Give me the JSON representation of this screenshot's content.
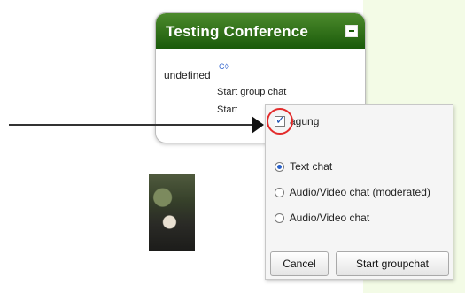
{
  "conference": {
    "title": "Testing Conference",
    "user_label": "undefined",
    "user_icon": "chat-icon",
    "menu": {
      "start_group_chat": "Start group chat",
      "start_partial": "Start"
    }
  },
  "dialog": {
    "participant": {
      "label": "agung",
      "checked": true
    },
    "chat_types": [
      {
        "label": "Text chat",
        "selected": true
      },
      {
        "label": "Audio/Video chat (moderated)",
        "selected": false
      },
      {
        "label": "Audio/Video chat",
        "selected": false
      }
    ],
    "buttons": {
      "cancel": "Cancel",
      "start": "Start groupchat"
    }
  },
  "colors": {
    "header_green": "#1a5a0a",
    "highlight_red": "#e32b2b",
    "side_panel": "#f3fbe6"
  }
}
